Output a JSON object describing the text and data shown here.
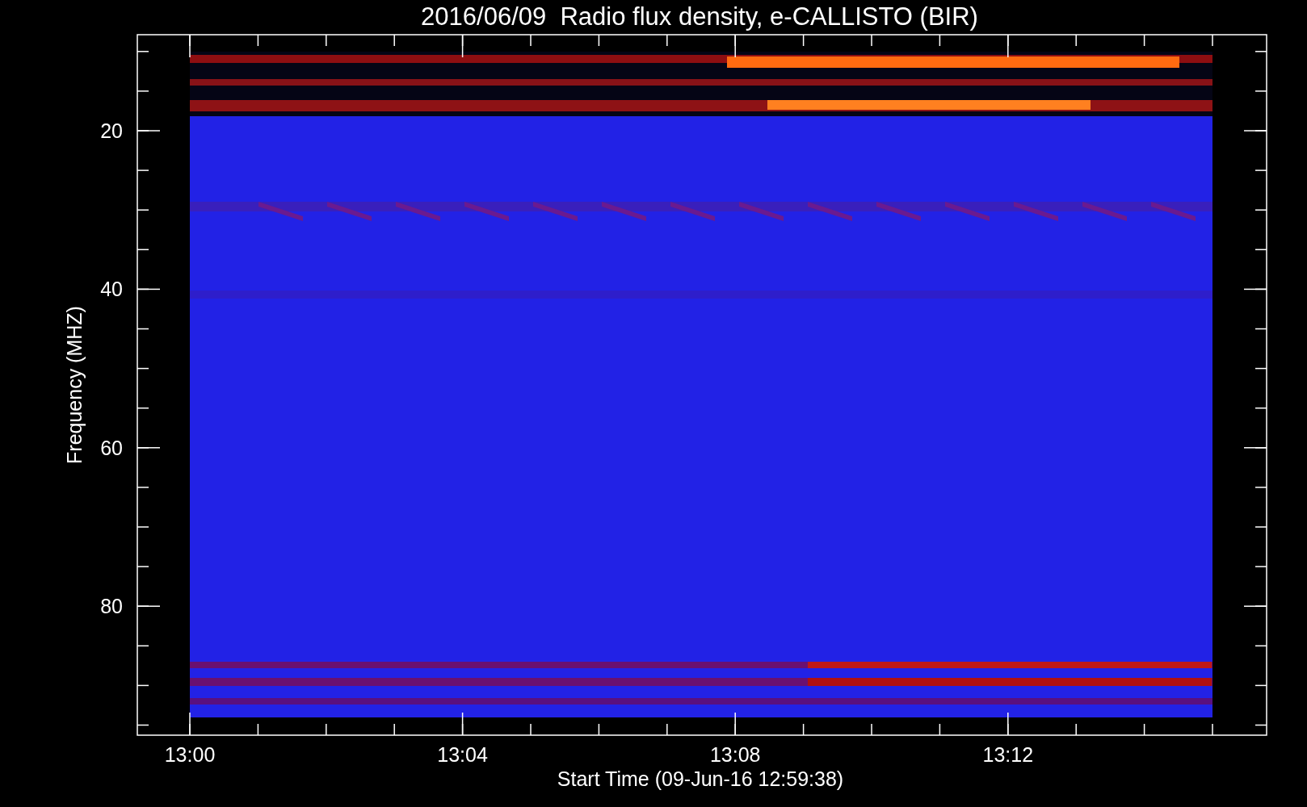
{
  "title": "2016/06/09  Radio flux density, e-CALLISTO (BIR)",
  "y_axis": {
    "label": "Frequency (MHZ)",
    "ticks": [
      "20",
      "40",
      "60",
      "80"
    ]
  },
  "x_axis": {
    "label": "Start Time (09-Jun-16 12:59:38)",
    "ticks": [
      "13:00",
      "13:04",
      "13:08",
      "13:12"
    ]
  }
}
